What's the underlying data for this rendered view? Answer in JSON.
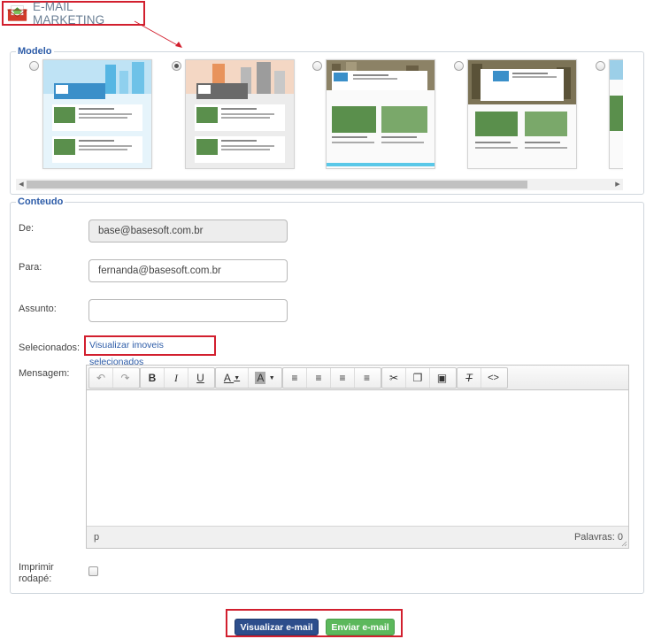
{
  "header": {
    "title": "E-MAIL MARKETING",
    "icon": "envelope-icon",
    "accent": "#d21f2e"
  },
  "modelo": {
    "legend": "Modelo",
    "templates": [
      {
        "name": "template-1",
        "selected": false
      },
      {
        "name": "template-2",
        "selected": true
      },
      {
        "name": "template-3",
        "selected": false
      },
      {
        "name": "template-4",
        "selected": false
      },
      {
        "name": "template-5",
        "selected": false
      }
    ]
  },
  "conteudo": {
    "legend": "Conteudo",
    "de": {
      "label": "De:",
      "value": "base@basesoft.com.br"
    },
    "para": {
      "label": "Para:",
      "value": "fernanda@basesoft.com.br"
    },
    "assunto": {
      "label": "Assunto:",
      "value": ""
    },
    "selecionados": {
      "label": "Selecionados:",
      "link": "Visualizar imoveis selecionados"
    },
    "mensagem": {
      "label": "Mensagem:",
      "status_path": "p",
      "word_count": "Palavras: 0",
      "toolbar": [
        "undo-icon",
        "redo-icon",
        "bold-icon",
        "italic-icon",
        "underline-icon",
        "text-color-icon",
        "background-color-icon",
        "align-left-icon",
        "align-center-icon",
        "align-right-icon",
        "justify-icon",
        "cut-icon",
        "copy-icon",
        "paste-icon",
        "clear-format-icon",
        "source-code-icon"
      ]
    },
    "rodape": {
      "label": "Imprimir rodapé:",
      "checked": false
    }
  },
  "actions": {
    "visualizar": "Visualizar e-mail",
    "enviar": "Enviar e-mail"
  },
  "colors": {
    "primary_button": "#2d4e8c",
    "success_button": "#5cb85c",
    "legend": "#2d5ca8"
  }
}
